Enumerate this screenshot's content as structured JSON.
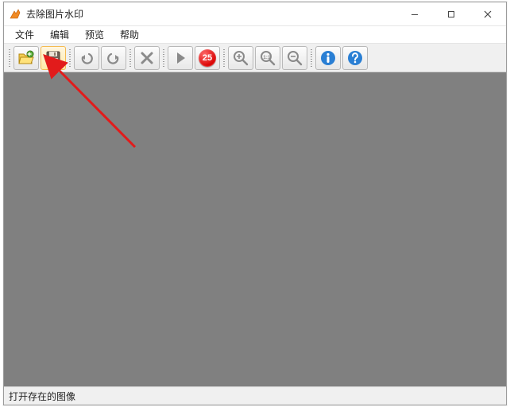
{
  "title": "去除图片水印",
  "window_controls": {
    "min": "minimize",
    "max": "maximize",
    "close": "close"
  },
  "menu": [
    "文件",
    "编辑",
    "预览",
    "帮助"
  ],
  "toolbar": {
    "open_tip": "Open",
    "save_tip": "Save",
    "undo_tip": "Undo",
    "redo_tip": "Redo",
    "delete_tip": "Delete",
    "run_tip": "Run",
    "badge_value": "25",
    "zoom_in_tip": "Zoom In",
    "zoom_11_tip": "1:1",
    "zoom_out_tip": "Zoom Out",
    "info_tip": "Info",
    "help_tip": "Help"
  },
  "status": "打开存在的图像",
  "colors": {
    "accent_red": "#d90000",
    "accent_blue": "#2a7fd4",
    "canvas_bg": "#808080"
  }
}
